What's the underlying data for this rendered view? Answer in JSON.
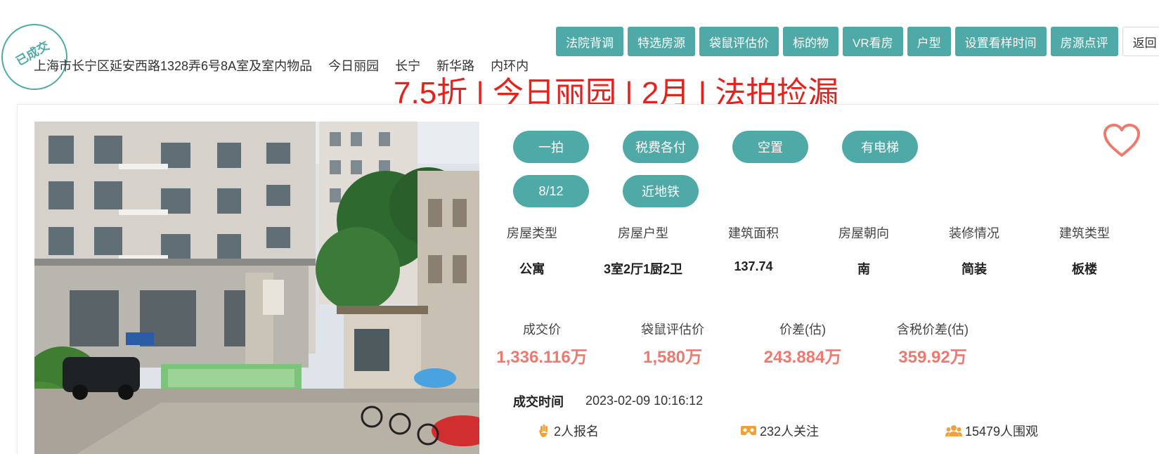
{
  "nav": {
    "buttons": [
      "法院背调",
      "特选房源",
      "袋鼠评估价",
      "标的物",
      "VR看房",
      "户型",
      "设置看样时间",
      "房源点评"
    ],
    "back": "返回"
  },
  "stamp": "已成交",
  "address": {
    "full": "上海市长宁区延安西路1328弄6号8A室及室内物品",
    "community": "今日丽园",
    "district": "长宁",
    "area": "新华路",
    "ring": "内环内"
  },
  "headline": "7.5折 | 今日丽园 | 2月 | 法拍捡漏",
  "tags": [
    "一拍",
    "税费各付",
    "空置",
    "有电梯",
    "8/12",
    "近地铁"
  ],
  "specs": [
    {
      "label": "房屋类型",
      "value": "公寓"
    },
    {
      "label": "房屋户型",
      "value": "3室2厅1厨2卫"
    },
    {
      "label": "建筑面积",
      "value": "137.74"
    },
    {
      "label": "房屋朝向",
      "value": "南"
    },
    {
      "label": "装修情况",
      "value": "简装"
    },
    {
      "label": "建筑类型",
      "value": "板楼"
    }
  ],
  "prices": [
    {
      "label": "成交价",
      "value": "1,336.116万"
    },
    {
      "label": "袋鼠评估价",
      "value": "1,580万"
    },
    {
      "label": "价差(估)",
      "value": "243.884万"
    },
    {
      "label": "含税价差(估)",
      "value": "359.92万"
    }
  ],
  "deal": {
    "label": "成交时间",
    "time": "2023-02-09 10:16:12"
  },
  "stats": {
    "signup": "2人报名",
    "follow": "232人关注",
    "watch": "15479人围观"
  },
  "colors": {
    "accent": "#4fa9a6",
    "price": "#ee7a6f",
    "headline": "#e8211b",
    "heart": "#ee7a6f"
  },
  "icons": {
    "heart": "heart-icon",
    "hand": "hand-icon",
    "vr": "vr-glasses-icon",
    "people": "people-icon"
  }
}
